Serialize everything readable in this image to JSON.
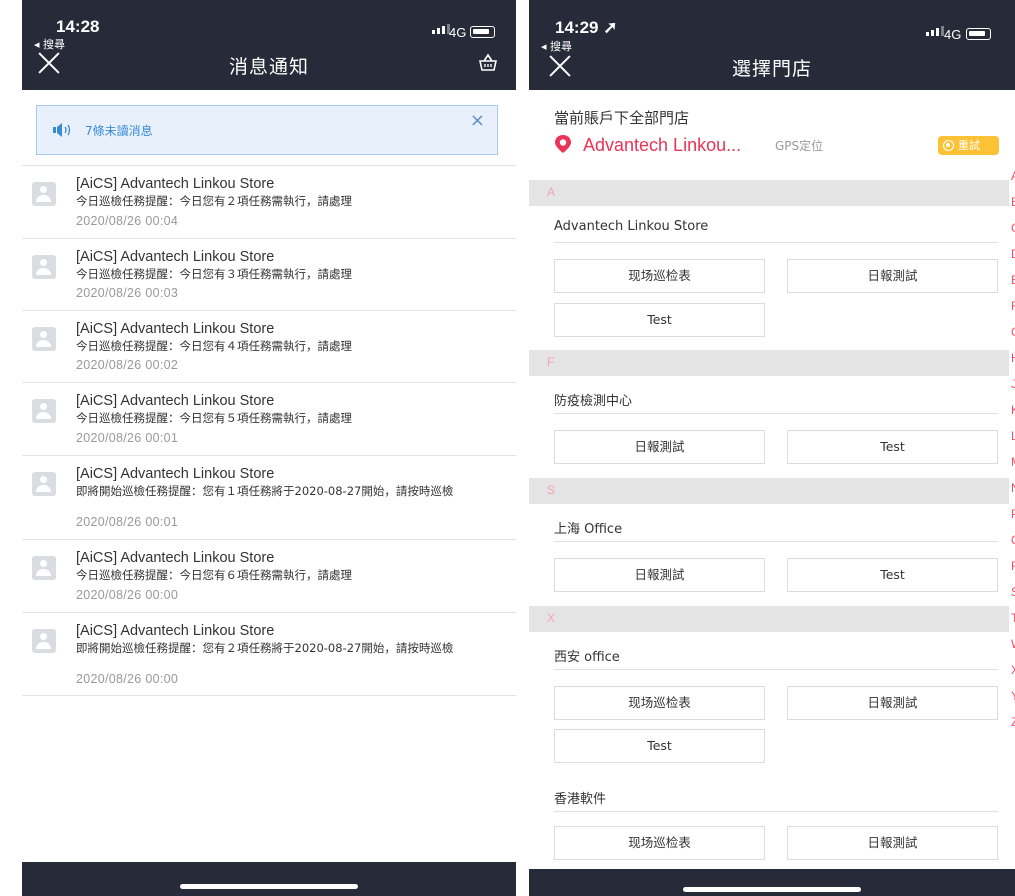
{
  "left": {
    "status": {
      "time": "14:28",
      "back": "◂ 搜尋",
      "network": "4G"
    },
    "nav": {
      "title": "消息通知"
    },
    "unread_banner": {
      "text": "7條未讀消息"
    },
    "messages": [
      {
        "title": "[AiCS] Advantech Linkou Store",
        "body": "今日巡檢任務提醒：今日您有２項任務需執行，請處理",
        "date": "2020/08/26  00:04"
      },
      {
        "title": "[AiCS] Advantech Linkou Store",
        "body": "今日巡檢任務提醒：今日您有３項任務需執行，請處理",
        "date": "2020/08/26  00:03"
      },
      {
        "title": "[AiCS] Advantech Linkou Store",
        "body": "今日巡檢任務提醒：今日您有４項任務需執行，請處理",
        "date": "2020/08/26  00:02"
      },
      {
        "title": "[AiCS] Advantech Linkou Store",
        "body": "今日巡檢任務提醒：今日您有５項任務需執行，請處理",
        "date": "2020/08/26  00:01"
      },
      {
        "title": "[AiCS] Advantech Linkou Store",
        "body": "即將開始巡檢任務提醒：您有１項任務將于2020-08-27開始，請按時巡檢",
        "date": "2020/08/26  00:01"
      },
      {
        "title": "[AiCS] Advantech Linkou Store",
        "body": "今日巡檢任務提醒：今日您有６項任務需執行，請處理",
        "date": "2020/08/26  00:00"
      },
      {
        "title": "[AiCS] Advantech Linkou Store",
        "body": "即將開始巡檢任務提醒：您有２項任務將于2020-08-27開始，請按時巡檢",
        "date": "2020/08/26  00:00"
      }
    ]
  },
  "right": {
    "status": {
      "time": "14:29 ➚",
      "back": "◂ 搜尋",
      "network": "4G"
    },
    "nav": {
      "title": "選擇門店"
    },
    "header": "當前賬戶下全部門店",
    "current_store": "Advantech Linkou...",
    "gps_label": "GPS定位",
    "retry_label": "重試",
    "sections": [
      {
        "letter": "A",
        "stores": [
          {
            "name": "Advantech Linkou Store",
            "buttons": [
              "现场巡检表",
              "日報測試",
              "Test"
            ]
          }
        ]
      },
      {
        "letter": "F",
        "stores": [
          {
            "name": "防疫檢測中心",
            "buttons": [
              "日報測試",
              "Test"
            ]
          }
        ]
      },
      {
        "letter": "S",
        "stores": [
          {
            "name": "上海 Office",
            "buttons": [
              "日報測試",
              "Test"
            ]
          }
        ]
      },
      {
        "letter": "X",
        "stores": [
          {
            "name": "西安 office",
            "buttons": [
              "现场巡检表",
              "日報測試",
              "Test"
            ]
          },
          {
            "name": "香港軟件",
            "buttons": [
              "现场巡检表",
              "日報測試"
            ]
          }
        ]
      }
    ],
    "index_letters": [
      "A",
      "B",
      "C",
      "D",
      "E",
      "F",
      "G",
      "H",
      "J",
      "K",
      "L",
      "M",
      "N",
      "P",
      "Q",
      "R",
      "S",
      "T",
      "W",
      "X",
      "Y",
      "Z"
    ],
    "accent_color": "#ea3356"
  }
}
